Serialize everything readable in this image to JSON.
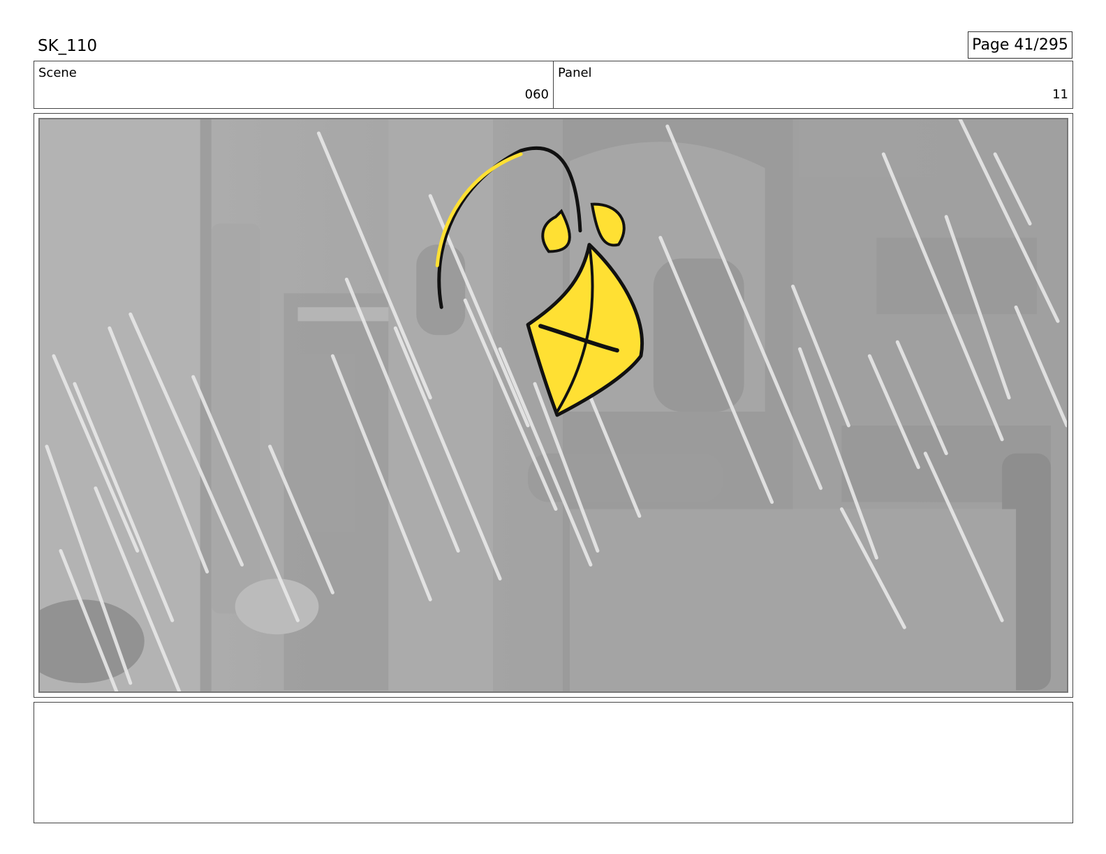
{
  "header": {
    "project": "SK_110",
    "page": "Page  41/295"
  },
  "info": {
    "scene_label": "Scene",
    "scene_value": "060",
    "panel_label": "Panel",
    "panel_value": "11"
  },
  "panel": {
    "image_subject": "yellow-kite-in-rain",
    "kite_color": "#ffe033",
    "background_color": "#a9a9a9"
  },
  "notes": {
    "text": ""
  }
}
